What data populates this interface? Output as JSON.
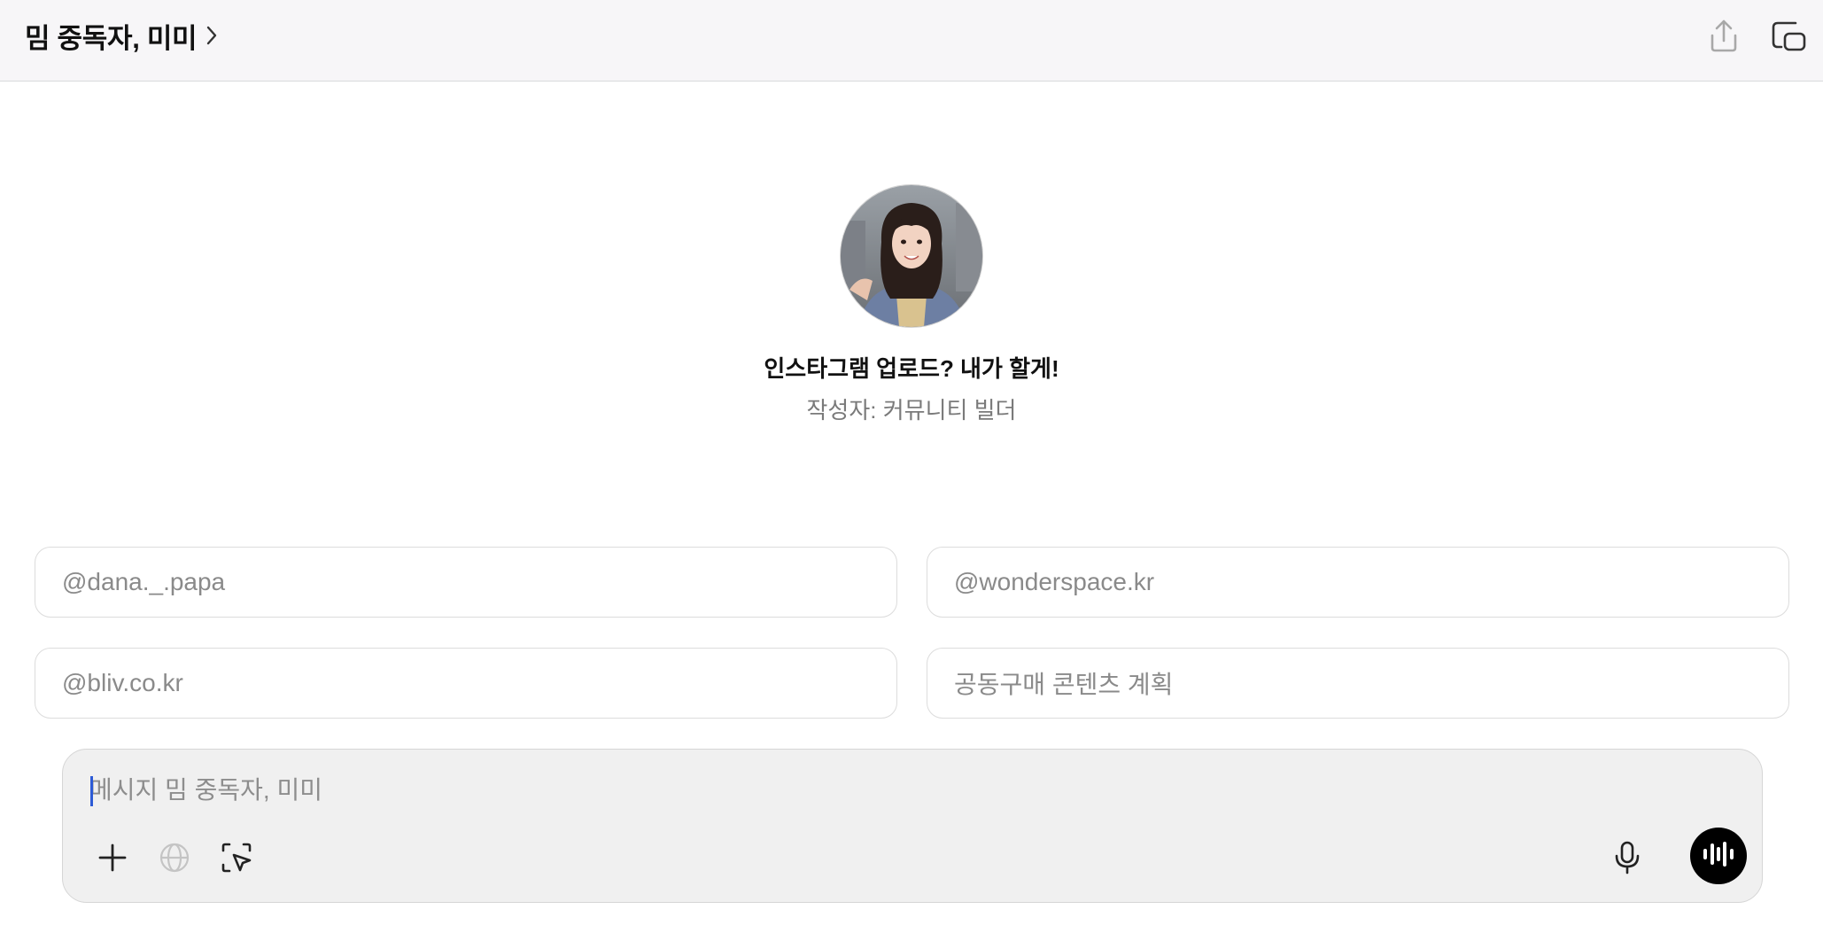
{
  "header": {
    "title": "밈 중독자, 미미",
    "icons": [
      "chevron-right-icon",
      "share-icon",
      "new-window-icon"
    ]
  },
  "profile": {
    "name": "인스타그램 업로드? 내가 할게!",
    "author": "작성자: 커뮤니티 빌더"
  },
  "suggestions": [
    {
      "label": "@dana._.papa"
    },
    {
      "label": "@wonderspace.kr"
    },
    {
      "label": "@bliv.co.kr"
    },
    {
      "label": "공동구매 콘텐츠 계획"
    }
  ],
  "composer": {
    "placeholder": "메시지 밈 중독자, 미미",
    "value": "",
    "icons": [
      "plus-icon",
      "globe-icon",
      "select-cursor-icon",
      "microphone-icon",
      "voice-waveform-icon"
    ]
  },
  "colors": {
    "topbar_bg": "#f7f6f8",
    "composer_bg": "#f0f0f0",
    "voice_button": "#000000",
    "caret": "#2d5bd6"
  }
}
